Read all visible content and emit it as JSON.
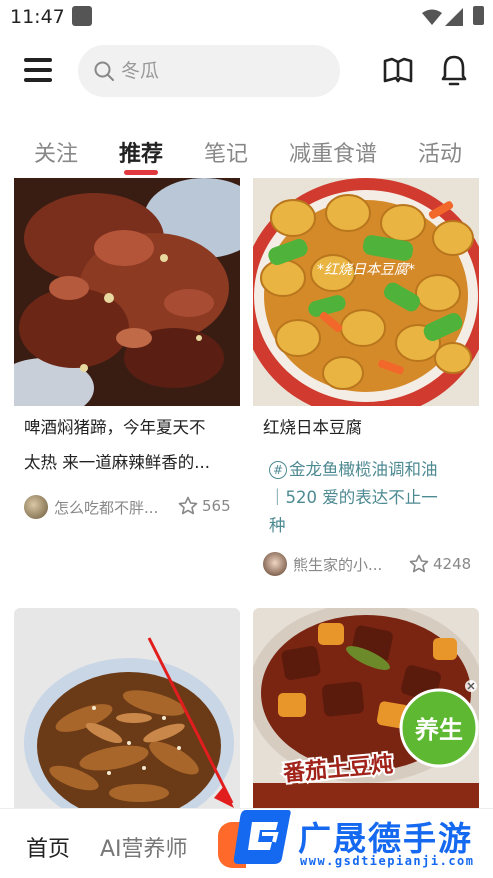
{
  "status_bar": {
    "time": "11:47"
  },
  "search": {
    "placeholder": "冬瓜"
  },
  "tabs": [
    {
      "label": "关注",
      "active": false
    },
    {
      "label": "推荐",
      "active": true
    },
    {
      "label": "笔记",
      "active": false
    },
    {
      "label": "减重食谱",
      "active": false
    },
    {
      "label": "活动",
      "active": false
    }
  ],
  "feed": [
    {
      "title_lines": [
        "啤酒焖猪蹄，今年夏天不",
        "太热 来一道麻辣鲜香的..."
      ],
      "author": "怎么吃都不胖...",
      "likes": "565",
      "image_description": "braised-pork-trotters"
    },
    {
      "title_lines": [
        "红烧日本豆腐"
      ],
      "image_caption": "*红烧日本豆腐*",
      "topic_lines": [
        "金龙鱼橄榄油调和油",
        "｜520 爱的表达不止一",
        "种"
      ],
      "author": "熊生家的小...",
      "likes": "4248",
      "image_description": "braised-japanese-tofu"
    },
    {
      "image_description": "spicy-tripe-dish"
    },
    {
      "image_caption": "番茄土豆炖",
      "image_badge": "养生",
      "image_description": "tomato-potato-beef-stew"
    }
  ],
  "bottom_nav": {
    "home": "首页",
    "ai_nutritionist": "AI营养师"
  },
  "watermark": {
    "title": "广晟德手游",
    "url": "www.gsdtiepianji.com"
  },
  "colors": {
    "accent_red": "#e0393e",
    "topic_teal": "#4d8a92",
    "watermark_blue": "#1569f0",
    "nav_orange": "#ff6a2b"
  }
}
